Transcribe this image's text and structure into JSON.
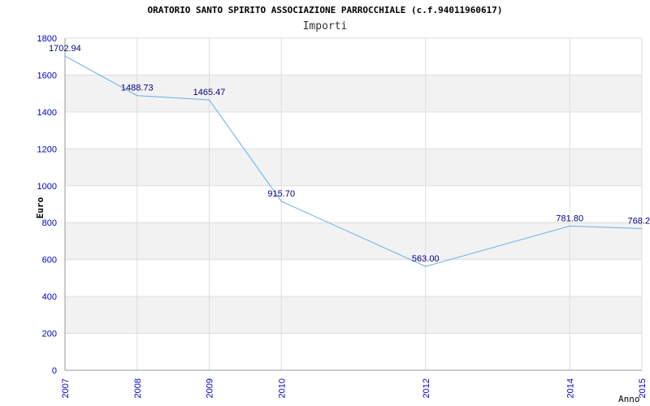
{
  "chart_data": {
    "type": "line",
    "title": "ORATORIO SANTO SPIRITO ASSOCIAZIONE PARROCCHIALE (c.f.94011960617)",
    "subtitle": "Importi",
    "xlabel": "Anno",
    "ylabel": "Euro",
    "ylim": [
      0,
      1800
    ],
    "yticks": [
      0,
      200,
      400,
      600,
      800,
      1000,
      1200,
      1400,
      1600,
      1800
    ],
    "xlim": [
      2007,
      2015
    ],
    "xticks": [
      2007,
      2008,
      2009,
      2010,
      2012,
      2014,
      2015
    ],
    "grid": true,
    "x": [
      2007,
      2008,
      2009,
      2010,
      2012,
      2014,
      2015
    ],
    "values": [
      1702.94,
      1488.73,
      1465.47,
      915.7,
      563.0,
      781.8,
      768.2
    ],
    "point_labels": [
      "1702.94",
      "1488.73",
      "1465.47",
      "915.70",
      "563.00",
      "781.80",
      "768.2"
    ],
    "colors": {
      "line": "#6aaee8",
      "label": "#000080",
      "tick": "#0000cc",
      "band": "#f2f2f2",
      "grid": "#dddddd",
      "axis": "#999999"
    }
  }
}
